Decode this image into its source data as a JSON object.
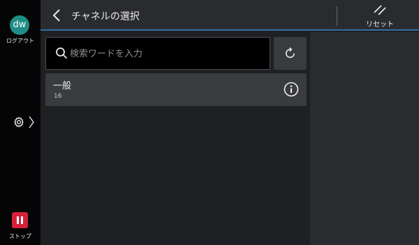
{
  "sidebar": {
    "avatar_initials": "dw",
    "logout_label": "ログアウト",
    "settings_icon": "gear-icon",
    "stop_label": "ストップ",
    "stop_color": "#d5203a",
    "avatar_color": "#1f8e86"
  },
  "header": {
    "title": "チャネルの選択",
    "reset_label": "リセット",
    "accent_color": "#2f6fa8"
  },
  "search": {
    "placeholder": "検索ワードを入力",
    "value": ""
  },
  "channels": [
    {
      "name": "一般",
      "count": "16"
    }
  ]
}
